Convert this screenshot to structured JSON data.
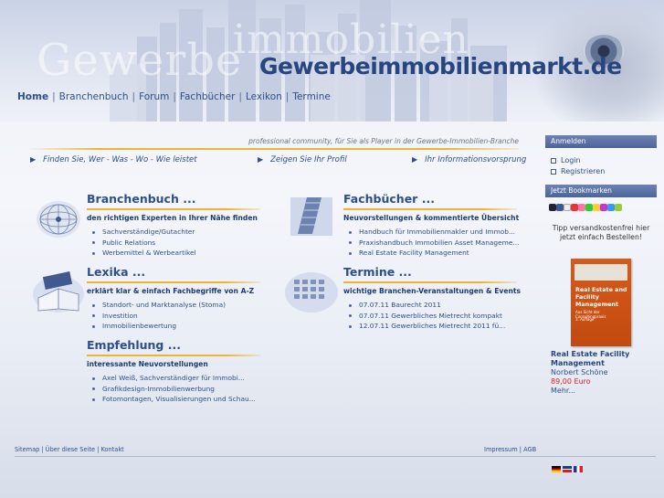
{
  "header": {
    "site_title": "Gewerbeimmobilienmarkt.de",
    "ghost_word_1": "Gewerbe",
    "ghost_word_2": "immobilien"
  },
  "nav": {
    "items": [
      {
        "label": "Home",
        "active": true
      },
      {
        "label": "Branchenbuch"
      },
      {
        "label": "Forum"
      },
      {
        "label": "Fachbücher"
      },
      {
        "label": "Lexikon"
      },
      {
        "label": "Termine"
      }
    ],
    "separator": "|"
  },
  "tagline": "professional community, für Sie als Player in der Gewerbe-Immobilien-Branche",
  "quicklinks": [
    "Finden Sie, Wer - Was - Wo - Wie leistet",
    "Zeigen Sie Ihr Profil",
    "Ihr Informationsvorsprung"
  ],
  "sections": {
    "branchenbuch": {
      "title": "Branchenbuch ...",
      "subtitle": "den richtigen Experten in Ihrer Nähe finden",
      "items": [
        "Sachverständige/Gutachter",
        "Public Relations",
        "Werbemittel & Werbeartikel"
      ]
    },
    "fachbuecher": {
      "title": "Fachbücher ...",
      "subtitle": "Neuvorstellungen & kommentierte Übersicht",
      "items": [
        "Handbuch für Immobilienmakler und Immob...",
        "Praxishandbuch Immobilien Asset Manageme...",
        "Real Estate Facility Management"
      ]
    },
    "lexika": {
      "title": "Lexika ...",
      "subtitle": "erklärt klar & einfach Fachbegriffe von A-Z",
      "items": [
        "Standort- und Marktanalyse (Stoma)",
        "Investition",
        "Immobilienbewertung"
      ]
    },
    "termine": {
      "title": "Termine ...",
      "subtitle": "wichtige Branchen-Veranstaltungen & Events",
      "items": [
        "07.07.11 Baurecht 2011",
        "07.07.11 Gewerbliches Mietrecht kompakt",
        "12.07.11 Gewerbliches Mietrecht 2011 fü..."
      ]
    },
    "empfehlung": {
      "title": "Empfehlung ...",
      "subtitle": "interessante Neuvorstellungen",
      "items": [
        "Axel Weiß, Sachverständiger für Immobi...",
        "Grafikdesign-Immobilienwerbung",
        "Fotomontagen, Visualisierungen und Schau..."
      ]
    }
  },
  "sidebar": {
    "login_header": "Anmelden",
    "login": "Login",
    "register": "Registrieren",
    "bookmarks_header": "Jetzt Bookmarken",
    "tip": "Tipp versandkostenfrei hier jetzt einfach Bestellen!",
    "book": {
      "cover_title": "Real Estate and Facility Management",
      "cover_sub": "Aus Sicht der Consultingpraxis",
      "cover_edition": "3. Auflage",
      "title": "Real Estate Facility Management",
      "author": "Norbert Schöne",
      "price": "89,00 Euro",
      "more": "Mehr..."
    }
  },
  "footer": {
    "left": [
      "Sitemap",
      "Über diese Seite",
      "Kontakt"
    ],
    "right": [
      "Impressum",
      "AGB"
    ],
    "separator": "|"
  },
  "colors": {
    "link": "#2d4f8c",
    "accent": "#f1b32f",
    "sidebar_header": "#5a70a6"
  }
}
